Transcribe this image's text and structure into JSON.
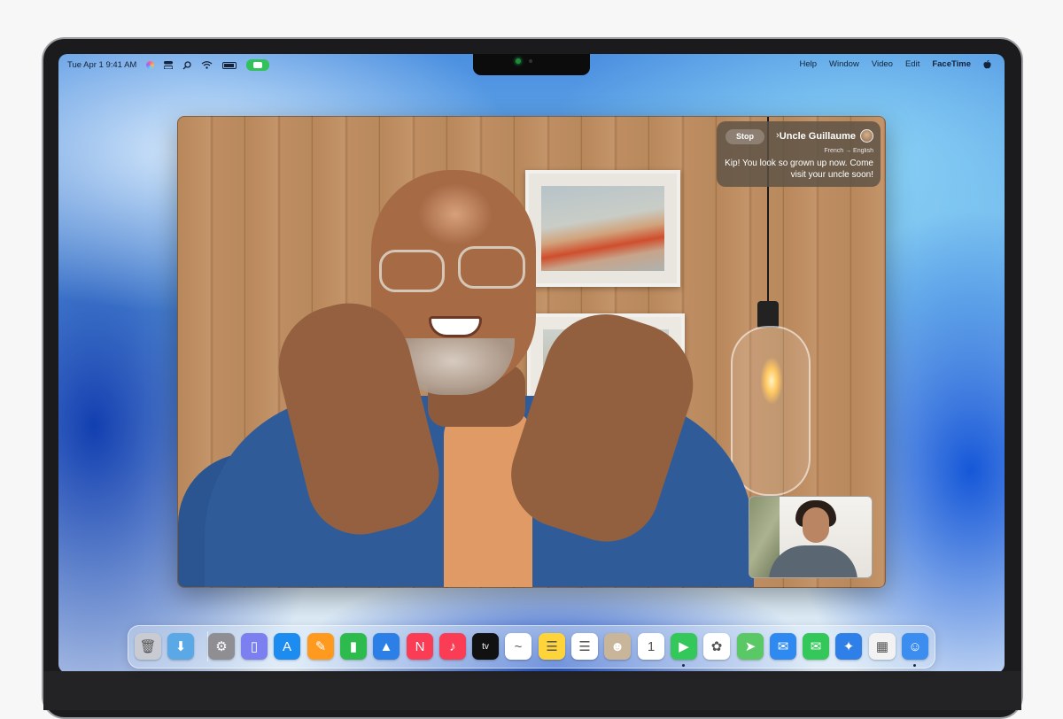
{
  "menubar": {
    "clock": "Tue Apr 1  9:41 AM",
    "app_name": "FaceTime",
    "menus": [
      "FaceTime",
      "Edit",
      "Video",
      "Window",
      "Help"
    ]
  },
  "caption": {
    "caller_name": "Uncle Guillaume",
    "chevron": "›",
    "stop_label": "Stop",
    "language": "French → English",
    "text": "Kip! You look so grown up now. Come visit your uncle soon!"
  },
  "dock": {
    "apps": [
      {
        "name": "finder-icon",
        "color": "#3b8df0",
        "glyph": "☺"
      },
      {
        "name": "launchpad-icon",
        "color": "#f2f2f2",
        "glyph": "▦"
      },
      {
        "name": "safari-icon",
        "color": "#2f7fe8",
        "glyph": "✦"
      },
      {
        "name": "messages-icon",
        "color": "#34c759",
        "glyph": "✉"
      },
      {
        "name": "mail-icon",
        "color": "#2e89f0",
        "glyph": "✉"
      },
      {
        "name": "maps-icon",
        "color": "#5ac864",
        "glyph": "➤"
      },
      {
        "name": "photos-icon",
        "color": "#ffffff",
        "glyph": "✿"
      },
      {
        "name": "facetime-icon",
        "color": "#34c759",
        "glyph": "▶"
      },
      {
        "name": "calendar-icon",
        "color": "#ffffff",
        "glyph": "1"
      },
      {
        "name": "contacts-icon",
        "color": "#c9b59a",
        "glyph": "☻"
      },
      {
        "name": "reminders-icon",
        "color": "#ffffff",
        "glyph": "☰"
      },
      {
        "name": "notes-icon",
        "color": "#ffd43b",
        "glyph": "☰"
      },
      {
        "name": "freeform-icon",
        "color": "#ffffff",
        "glyph": "~"
      },
      {
        "name": "tv-icon",
        "color": "#111111",
        "glyph": "tv"
      },
      {
        "name": "music-icon",
        "color": "#fa3c55",
        "glyph": "♪"
      },
      {
        "name": "news-icon",
        "color": "#fa3c55",
        "glyph": "N"
      },
      {
        "name": "keynote-icon",
        "color": "#2d7fe8",
        "glyph": "▲"
      },
      {
        "name": "numbers-icon",
        "color": "#2dbb4e",
        "glyph": "▮"
      },
      {
        "name": "pages-icon",
        "color": "#ff9a1f",
        "glyph": "✎"
      },
      {
        "name": "app-store-icon",
        "color": "#1d8cf0",
        "glyph": "A"
      },
      {
        "name": "iphone-mirroring-icon",
        "color": "#7b7ff0",
        "glyph": "▯"
      },
      {
        "name": "system-settings-icon",
        "color": "#8e8e93",
        "glyph": "⚙"
      },
      {
        "name": "downloads-folder-icon",
        "color": "#5aa8e6",
        "glyph": "⬇"
      },
      {
        "name": "trash-icon",
        "color": "#c8ccd2",
        "glyph": "🗑"
      }
    ]
  },
  "colors": {
    "facetime_green": "#32c15a",
    "caption_bg": "#5c5246"
  }
}
